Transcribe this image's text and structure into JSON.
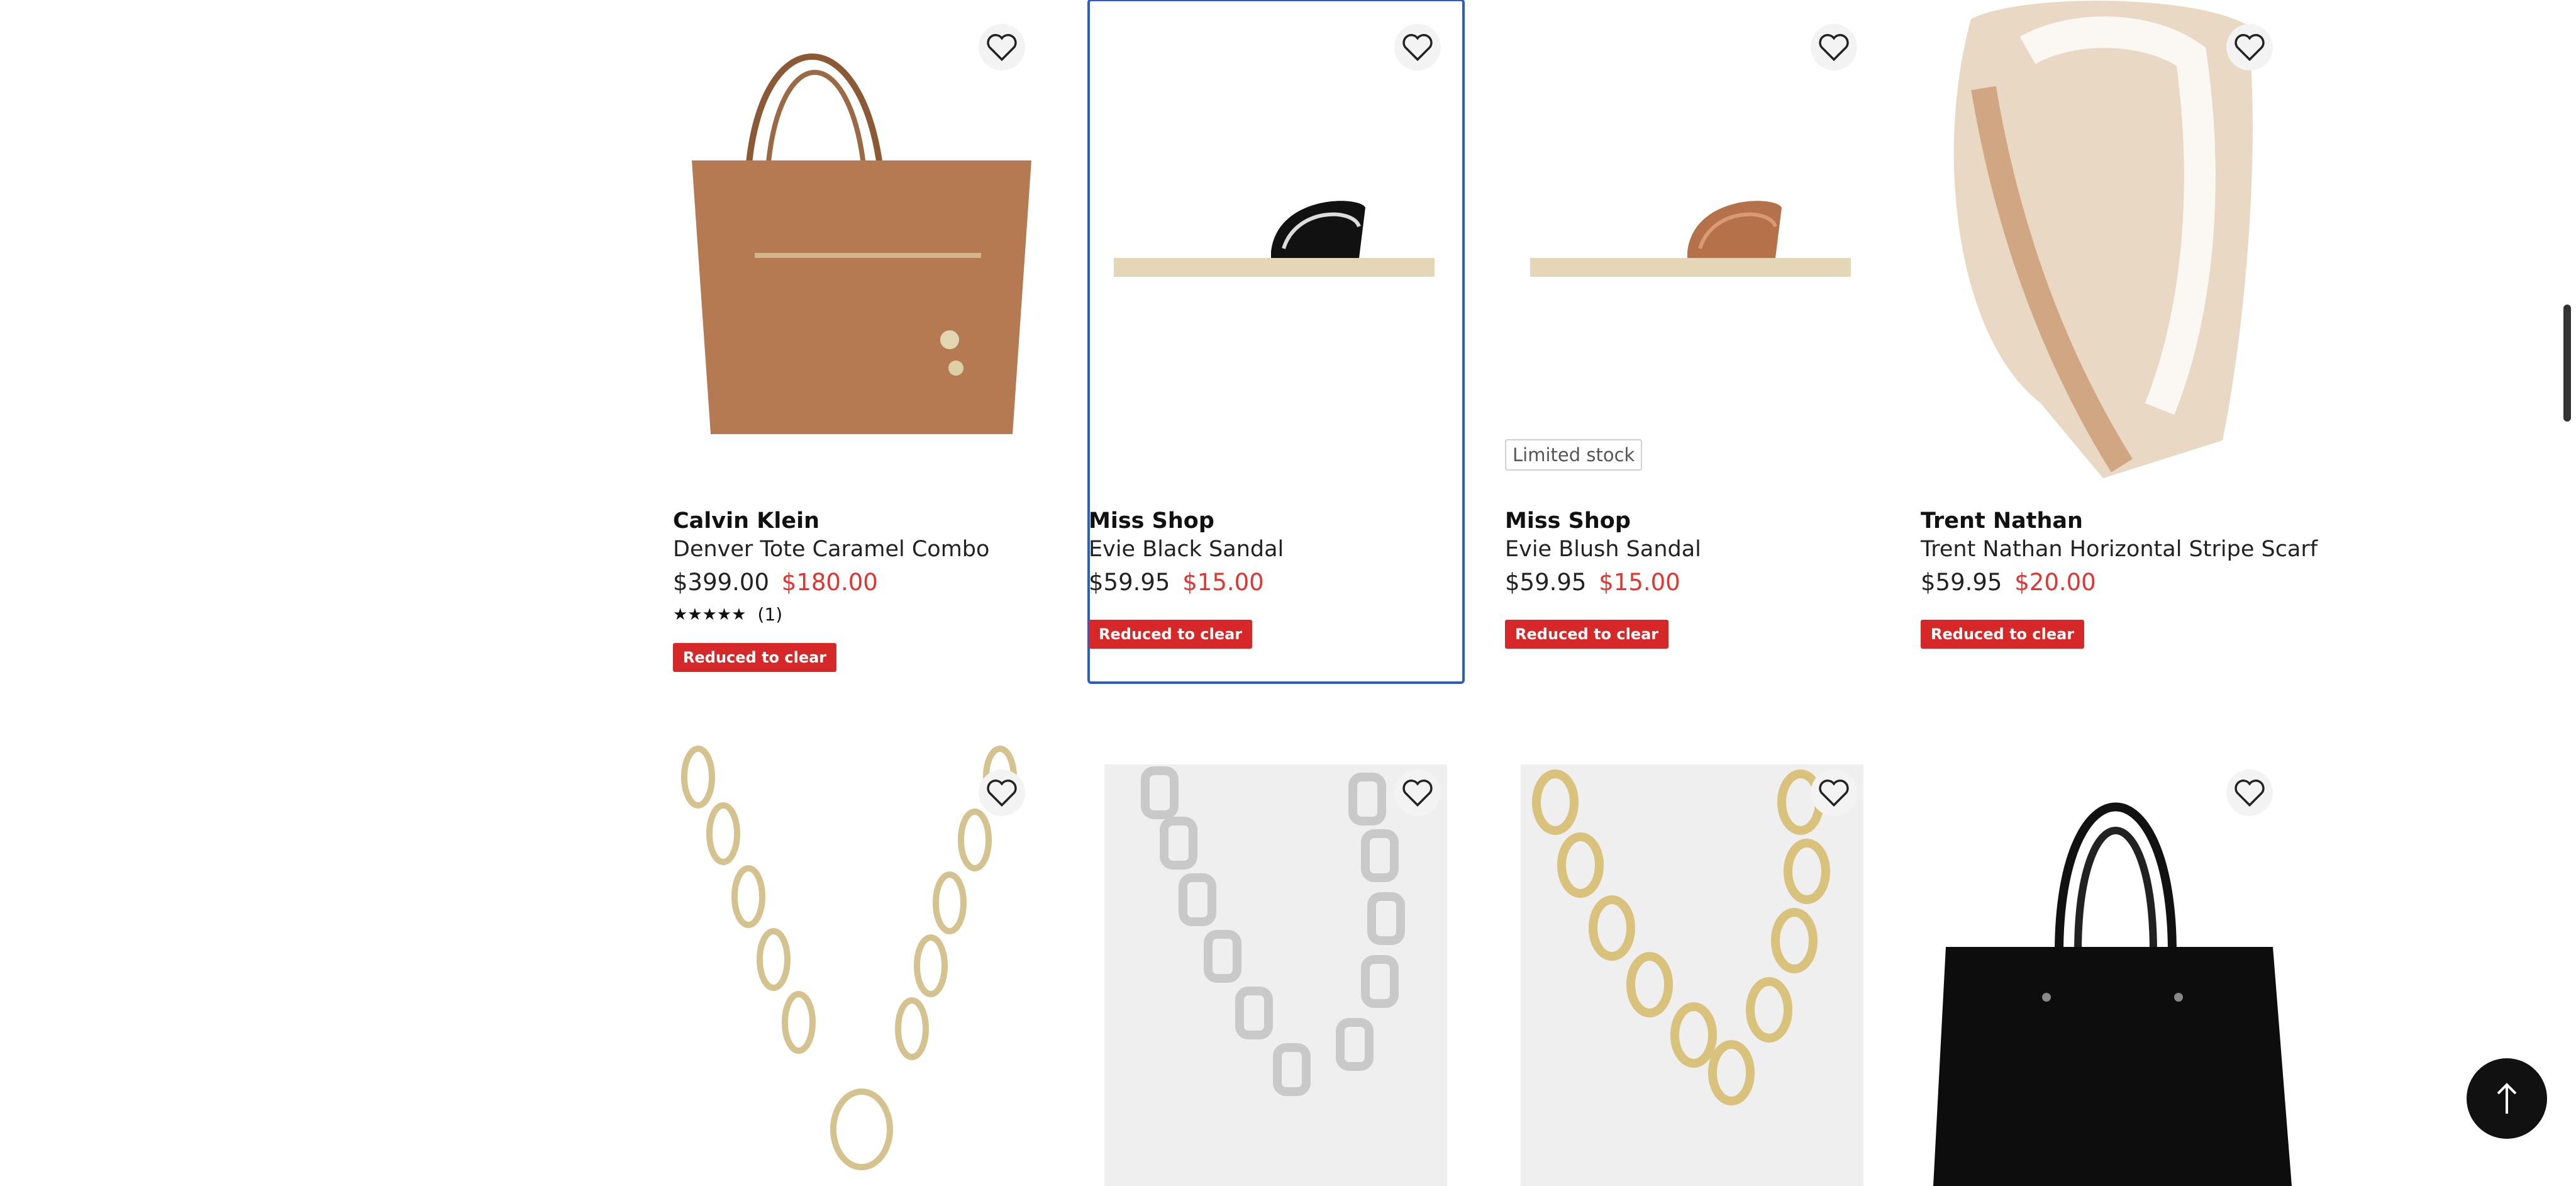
{
  "products_row1": [
    {
      "brand": "Calvin Klein",
      "name": "Denver Tote Caramel Combo",
      "was": "$399.00",
      "now": "$180.00",
      "stars": "★★★★★",
      "reviews": "(1)",
      "badge": "Reduced to clear"
    },
    {
      "brand": "Miss Shop",
      "name": "Evie Black Sandal",
      "was": "$59.95",
      "now": "$15.00",
      "badge": "Reduced to clear"
    },
    {
      "brand": "Miss Shop",
      "name": "Evie Blush Sandal",
      "was": "$59.95",
      "now": "$15.00",
      "badge": "Reduced to clear",
      "limited": "Limited stock"
    },
    {
      "brand": "Trent Nathan",
      "name": "Trent Nathan Horizontal Stripe Scarf",
      "was": "$59.95",
      "now": "$20.00",
      "badge": "Reduced to clear"
    }
  ],
  "colors": {
    "sale": "#e3342f",
    "badge": "#d62828",
    "focus": "#2a5ccc"
  },
  "icons": {
    "wishlist": "heart-icon",
    "back_to_top": "arrow-up-icon"
  }
}
